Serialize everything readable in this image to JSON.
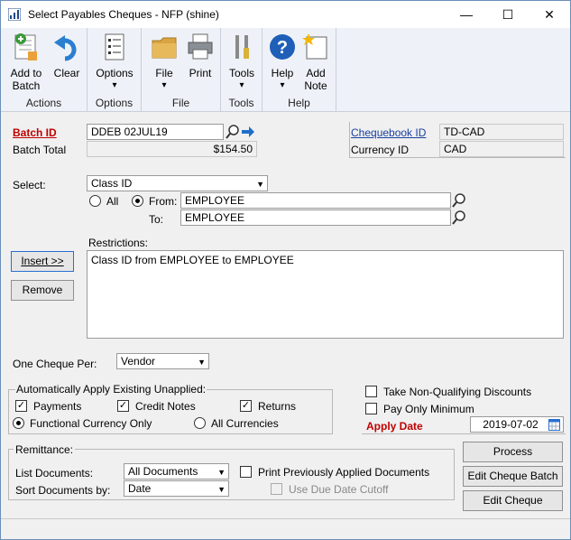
{
  "window": {
    "title": "Select Payables Cheques  -  NFP (shine)",
    "minimize": "—",
    "maximize": "☐",
    "close": "✕"
  },
  "ribbon": {
    "groups": [
      {
        "label": "Actions",
        "buttons": [
          {
            "line1": "Add to",
            "line2": "Batch"
          },
          {
            "line1": "Clear",
            "line2": ""
          }
        ]
      },
      {
        "label": "Options",
        "buttons": [
          {
            "line1": "Options",
            "line2": "▾"
          }
        ]
      },
      {
        "label": "File",
        "buttons": [
          {
            "line1": "File",
            "line2": "▾"
          },
          {
            "line1": "Print",
            "line2": ""
          }
        ]
      },
      {
        "label": "Tools",
        "buttons": [
          {
            "line1": "Tools",
            "line2": "▾"
          }
        ]
      },
      {
        "label": "Help",
        "buttons": [
          {
            "line1": "Help",
            "line2": "▾"
          },
          {
            "line1": "Add",
            "line2": "Note"
          }
        ]
      }
    ]
  },
  "form": {
    "batch_id_label": "Batch ID",
    "batch_id_value": "DDEB 02JUL19",
    "batch_total_label": "Batch Total",
    "batch_total_value": "$154.50",
    "chequebook_label": "Chequebook ID",
    "chequebook_value": "TD-CAD",
    "currency_label": "Currency ID",
    "currency_value": "CAD",
    "select_label": "Select:",
    "select_value": "Class ID",
    "all_label": "All",
    "from_label": "From:",
    "from_value": "EMPLOYEE",
    "to_label": "To:",
    "to_value": "EMPLOYEE",
    "restrictions_label": "Restrictions:",
    "restrictions_value": "Class ID from EMPLOYEE to EMPLOYEE",
    "insert_button": "Insert >>",
    "remove_button": "Remove",
    "one_cheque_label": "One Cheque Per:",
    "one_cheque_value": "Vendor",
    "auto_apply_label": "Automatically Apply Existing Unapplied:",
    "payments_label": "Payments",
    "credit_notes_label": "Credit Notes",
    "returns_label": "Returns",
    "functional_currency_label": "Functional Currency Only",
    "all_currencies_label": "All Currencies",
    "take_nonqual_label": "Take Non-Qualifying Discounts",
    "pay_only_min_label": "Pay Only Minimum",
    "apply_date_label": "Apply Date",
    "apply_date_value": "2019-07-02",
    "remittance_label": "Remittance:",
    "list_documents_label": "List Documents:",
    "list_documents_value": "All Documents",
    "sort_documents_label": "Sort Documents by:",
    "sort_documents_value": "Date",
    "print_prev_label": "Print Previously Applied Documents",
    "use_due_date_label": "Use Due Date Cutoff",
    "process_button": "Process",
    "edit_batch_button": "Edit Cheque Batch",
    "edit_cheque_button": "Edit Cheque"
  },
  "colors": {
    "required": "#c00000",
    "link": "#1a3fa0",
    "ribbon_bg": "#eef2f8"
  }
}
